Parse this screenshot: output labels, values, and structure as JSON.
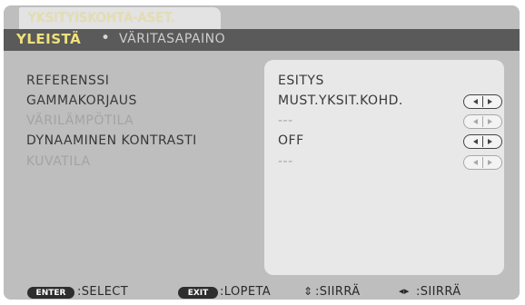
{
  "window": {
    "title": "YKSITYISKOHTA-ASET."
  },
  "tabs": [
    {
      "label": "YLEISTÄ",
      "active": true
    },
    {
      "label": "VÄRITASAPAINO",
      "active": false
    }
  ],
  "tab_separator": "•",
  "settings": [
    {
      "label": "REFERENSSI",
      "value": "ESITYS",
      "enabled": true,
      "has_arrows": false
    },
    {
      "label": "GAMMAKORJAUS",
      "value": "MUST.YKSIT.KOHD.",
      "enabled": true,
      "has_arrows": true
    },
    {
      "label": "VÄRILÄMPÖTILA",
      "value": "---",
      "enabled": false,
      "has_arrows": true
    },
    {
      "label": "DYNAAMINEN KONTRASTI",
      "value": "OFF",
      "enabled": true,
      "has_arrows": true
    },
    {
      "label": "KUVATILA",
      "value": "---",
      "enabled": false,
      "has_arrows": true
    }
  ],
  "footer": {
    "enter_key": "ENTER",
    "enter_text": ":SELECT",
    "exit_key": "EXIT",
    "exit_text": ":LOPETA",
    "updown_text": ":SIIRRÄ",
    "leftright_text": ":SIIRRÄ"
  },
  "colors": {
    "title_text": "#e8e0a8",
    "active_tab": "#f0e27a",
    "menu_bg": "#bebebe",
    "tabbar_bg": "#5a5a5a"
  }
}
